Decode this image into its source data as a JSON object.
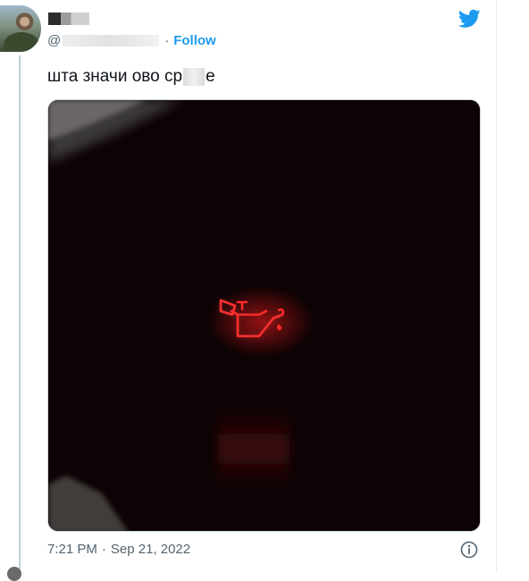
{
  "tweet": {
    "handle_prefix": "@",
    "dot": "·",
    "follow_label": "Follow",
    "text_before": "шта значи ово ср",
    "text_after": "е",
    "time": "7:21 PM",
    "separator": "·",
    "date": "Sep 21, 2022"
  },
  "icons": {
    "logo": "twitter-bird-icon",
    "info": "info-icon",
    "media_subject": "oil-pressure-warning-icon"
  },
  "colors": {
    "accent": "#1d9bf0",
    "secondary_text": "#536471",
    "warning_glow": "#ff1a1a"
  }
}
